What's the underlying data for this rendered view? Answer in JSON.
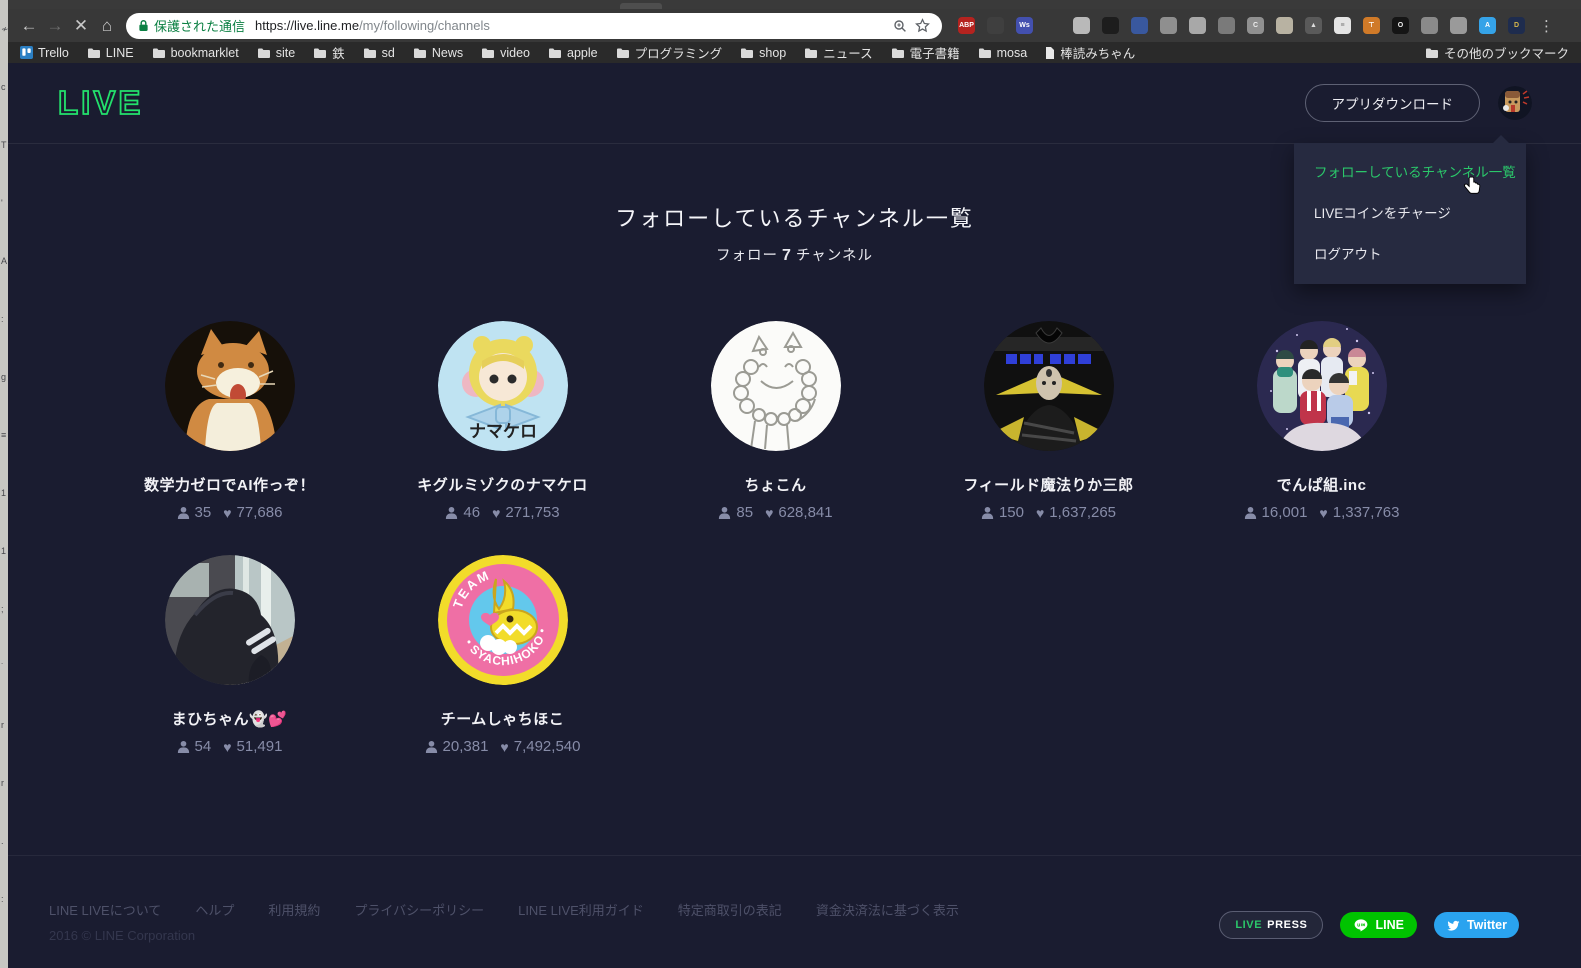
{
  "browser": {
    "security_label": "保護された通信",
    "url_host": "https://live.line.me",
    "url_path": "/my/following/channels",
    "nav": {
      "back": "←",
      "forward": "→",
      "stop": "✕",
      "home": "⌂"
    },
    "menu_dots": "⋮",
    "extensions": [
      {
        "name": "adblock",
        "bg": "#b5231f",
        "glyph": "ABP",
        "fg": "#ffffff"
      },
      {
        "name": "mail",
        "bg": "#3f3f3f",
        "glyph": "",
        "fg": "#ffffff"
      },
      {
        "name": "wordservice",
        "bg": "#4350af",
        "glyph": "Ws",
        "fg": "#ffffff"
      },
      {
        "name": "spacer",
        "spacer": true
      },
      {
        "name": "lamp",
        "bg": "#b9b9b9",
        "glyph": ""
      },
      {
        "name": "panda",
        "bg": "#1d1d1d",
        "glyph": ""
      },
      {
        "name": "flag",
        "bg": "#39589e",
        "glyph": ""
      },
      {
        "name": "swirl",
        "bg": "#8f8f8f",
        "glyph": ""
      },
      {
        "name": "bulb",
        "bg": "#a8a8a8",
        "glyph": ""
      },
      {
        "name": "shield",
        "bg": "#7a7a7a",
        "glyph": ""
      },
      {
        "name": "c-ext",
        "bg": "#909090",
        "glyph": "C",
        "fg": "#eeeeee"
      },
      {
        "name": "note",
        "bg": "#b8b2a2",
        "glyph": ""
      },
      {
        "name": "triangle",
        "bg": "#5a5a5a",
        "glyph": "▲",
        "fg": "#dddddd"
      },
      {
        "name": "doc",
        "bg": "#e4e4e4",
        "glyph": "≡",
        "fg": "#777777"
      },
      {
        "name": "tampermonkey",
        "bg": "#d07a28",
        "glyph": "⊤",
        "fg": "#ffffff"
      },
      {
        "name": "onetab",
        "bg": "#151515",
        "glyph": "O",
        "fg": "#eeeeee"
      },
      {
        "name": "gray-one",
        "bg": "#8a8a8a",
        "glyph": ""
      },
      {
        "name": "gray-two",
        "bg": "#9a9a9a",
        "glyph": ""
      },
      {
        "name": "translate",
        "bg": "#35a3e8",
        "glyph": "A",
        "fg": "#ffffff"
      },
      {
        "name": "d-ext",
        "bg": "#1e2c4e",
        "glyph": "D",
        "fg": "#d8b84a"
      }
    ],
    "bookmarks": {
      "items": [
        {
          "label": "Trello",
          "icon": "trello"
        },
        {
          "label": "LINE",
          "icon": "folder"
        },
        {
          "label": "bookmarklet",
          "icon": "folder"
        },
        {
          "label": "site",
          "icon": "folder"
        },
        {
          "label": "鉄",
          "icon": "folder"
        },
        {
          "label": "sd",
          "icon": "folder"
        },
        {
          "label": "News",
          "icon": "folder"
        },
        {
          "label": "video",
          "icon": "folder"
        },
        {
          "label": "apple",
          "icon": "folder"
        },
        {
          "label": "プログラミング",
          "icon": "folder"
        },
        {
          "label": "shop",
          "icon": "folder"
        },
        {
          "label": "ニュース",
          "icon": "folder"
        },
        {
          "label": "電子書籍",
          "icon": "folder"
        },
        {
          "label": "mosa",
          "icon": "folder"
        },
        {
          "label": "棒読みちゃん",
          "icon": "page"
        }
      ],
      "other_label": "その他のブックマーク"
    }
  },
  "header": {
    "logo": "LIVE",
    "download_label": "アプリダウンロード"
  },
  "menu": {
    "items": [
      {
        "label": "フォローしているチャンネル一覧",
        "active": true
      },
      {
        "label": "LIVEコインをチャージ",
        "active": false
      },
      {
        "label": "ログアウト",
        "active": false
      }
    ]
  },
  "page": {
    "title": "フォローしているチャンネル一覧",
    "subtitle_prefix": "フォロー",
    "subtitle_count": "7",
    "subtitle_suffix": "チャンネル"
  },
  "channels": [
    {
      "name": "数学力ゼロでAI作っぞ！",
      "followers": "35",
      "hearts": "77,686"
    },
    {
      "name": "キグルミゾクのナマケロ",
      "followers": "46",
      "hearts": "271,753"
    },
    {
      "name": "ちょこん",
      "followers": "85",
      "hearts": "628,841"
    },
    {
      "name": "フィールド魔法りか三郎",
      "followers": "150",
      "hearts": "1,637,265"
    },
    {
      "name": "でんぱ組.inc",
      "followers": "16,001",
      "hearts": "1,337,763"
    },
    {
      "name": "まひちゃん👻💕",
      "followers": "54",
      "hearts": "51,491"
    },
    {
      "name": "チームしゃちほこ",
      "followers": "20,381",
      "hearts": "7,492,540"
    }
  ],
  "footer": {
    "links": [
      "LINE LIVEについて",
      "ヘルプ",
      "利用規約",
      "プライバシーポリシー",
      "LINE LIVE利用ガイド",
      "特定商取引の表記",
      "資金決済法に基づく表示"
    ],
    "copyright": "2016 © LINE Corporation",
    "press_live": "LIVE",
    "press_rest": "PRESS",
    "line_label": "LINE",
    "twitter_label": "Twitter"
  },
  "colors": {
    "accent_green": "#2bc76a",
    "line_green": "#00c300",
    "twitter_blue": "#2aa3ef",
    "page_bg": "#1a1c30",
    "dropdown_bg": "#262a40",
    "secure_green": "#0b8043"
  }
}
